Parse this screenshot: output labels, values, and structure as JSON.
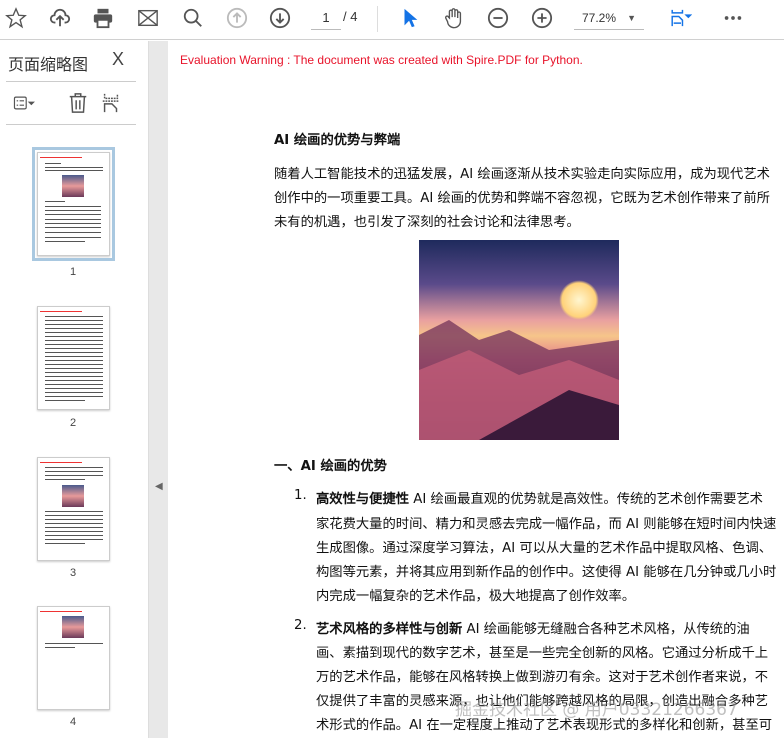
{
  "toolbar": {
    "page_current": "1",
    "page_total": "/ 4",
    "zoom": "77.2%"
  },
  "sidebar": {
    "title": "页面缩略图",
    "close": "X",
    "thumbnails": [
      {
        "label": "1"
      },
      {
        "label": "2"
      },
      {
        "label": "3"
      },
      {
        "label": "4"
      }
    ]
  },
  "document": {
    "warning": "Evaluation Warning : The document was created with Spire.PDF for Python.",
    "title": "AI 绘画的优势与弊端",
    "intro": [
      "随着人工智能技术的迅猛发展，AI 绘画逐渐从技术实验走向实际应用，成为现代艺术",
      "创作中的一项重要工具。AI 绘画的优势和弊端不容忽视，它既为艺术创作带来了前所",
      "未有的机遇，也引发了深刻的社会讨论和法律思考。"
    ],
    "section1": "一、AI 绘画的优势",
    "items": [
      {
        "num": "1.",
        "bold": "高效性与便捷性",
        "lines": [
          " AI 绘画最直观的优势就是高效性。传统的艺术创作需要艺术",
          "家花费大量的时间、精力和灵感去完成一幅作品，而 AI 则能够在短时间内快速",
          "生成图像。通过深度学习算法，AI 可以从大量的艺术作品中提取风格、色调、",
          "构图等元素，并将其应用到新作品的创作中。这使得 AI 能够在几分钟或几小时",
          "内完成一幅复杂的艺术作品，极大地提高了创作效率。"
        ]
      },
      {
        "num": "2.",
        "bold": "艺术风格的多样性与创新",
        "lines": [
          " AI 绘画能够无缝融合各种艺术风格，从传统的油",
          "画、素描到现代的数字艺术，甚至是一些完全创新的风格。它通过分析成千上",
          "万的艺术作品，能够在风格转换上做到游刃有余。这对于艺术创作者来说，不",
          "仅提供了丰富的灵感来源，也让他们能够跨越风格的局限，创造出融合多种艺",
          "术形式的作品。AI 在一定程度上推动了艺术表现形式的多样化和创新，甚至可"
        ]
      }
    ]
  },
  "watermark": "掘金技术社区 @ 用户03321266367",
  "colors": {
    "accent": "#1473e6",
    "warning": "#e8132a"
  }
}
